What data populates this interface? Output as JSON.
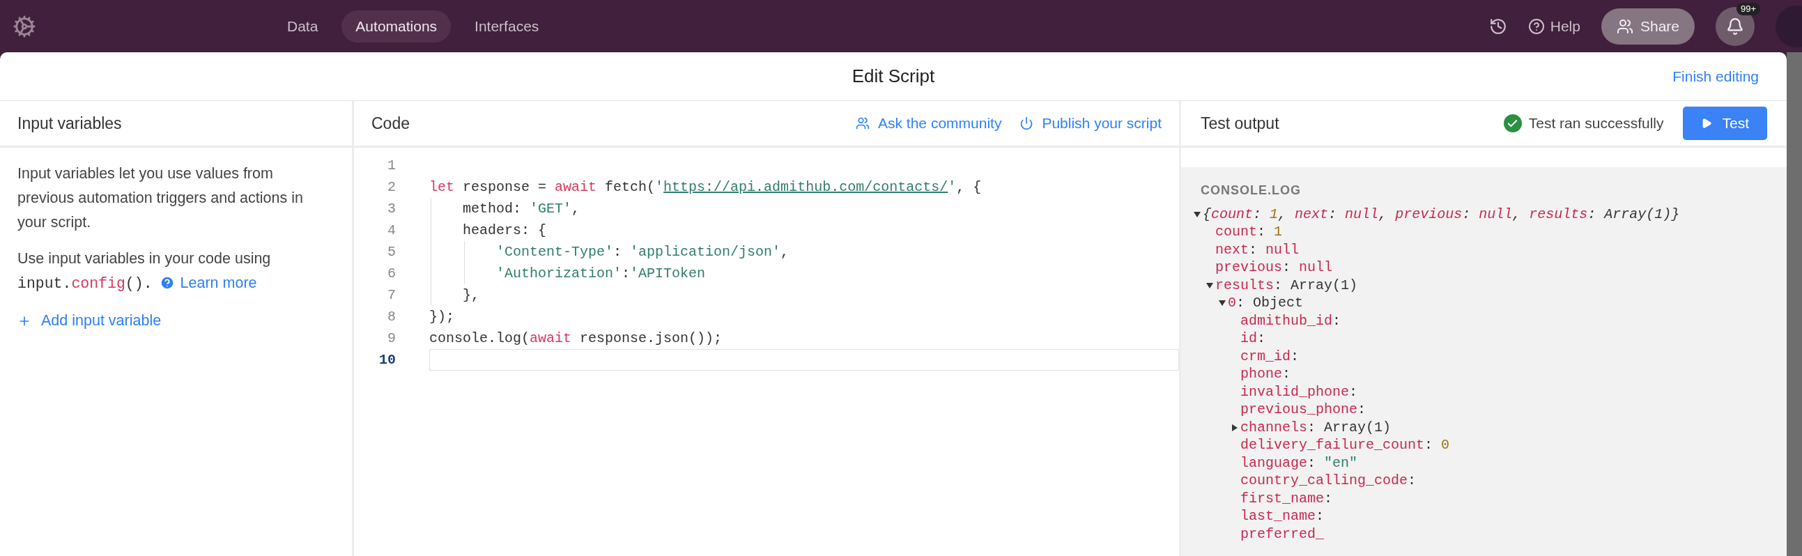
{
  "top_nav": {
    "tabs": [
      {
        "label": "Data",
        "selected": false
      },
      {
        "label": "Automations",
        "selected": true
      },
      {
        "label": "Interfaces",
        "selected": false
      }
    ],
    "help": "Help",
    "share": "Share",
    "notification_badge": "99+"
  },
  "dialog": {
    "title": "Edit Script",
    "finish": "Finish editing"
  },
  "input_panel": {
    "title": "Input variables",
    "description": "Input variables let you use values from previous automation triggers and actions in your script.",
    "usage": [
      {
        "kind": "text",
        "text": "Use input variables in your code using "
      },
      {
        "kind": "code",
        "text": "input."
      },
      {
        "kind": "code_red",
        "text": "config"
      },
      {
        "kind": "code",
        "text": "()."
      }
    ],
    "learn_more": "Learn more",
    "add": "Add input variable"
  },
  "code_panel": {
    "title": "Code",
    "ask": "Ask the community",
    "publish": "Publish your script",
    "lines": [
      {
        "number": "1",
        "current": false
      },
      {
        "number": "2",
        "current": false,
        "tokens": [
          {
            "kind": "keyword",
            "text": "let"
          },
          {
            "kind": "plain",
            "text": " response = "
          },
          {
            "kind": "keyword",
            "text": "await"
          },
          {
            "kind": "plain",
            "text": " fetch("
          },
          {
            "kind": "string",
            "text": "'"
          },
          {
            "kind": "link",
            "text": "https://api.admithub.com/contacts/"
          },
          {
            "kind": "string",
            "text": "'"
          },
          {
            "kind": "plain",
            "text": ", {"
          }
        ]
      },
      {
        "number": "3",
        "current": false,
        "tokens": [
          {
            "kind": "plain",
            "text": "    method: "
          },
          {
            "kind": "string",
            "text": "'GET'"
          },
          {
            "kind": "plain",
            "text": ","
          }
        ]
      },
      {
        "number": "4",
        "current": false,
        "tokens": [
          {
            "kind": "plain",
            "text": "    headers: {"
          }
        ]
      },
      {
        "number": "5",
        "current": false,
        "tokens": [
          {
            "kind": "string",
            "text": "        'Content-Type'"
          },
          {
            "kind": "plain",
            "text": ": "
          },
          {
            "kind": "string",
            "text": "'application/json'"
          },
          {
            "kind": "plain",
            "text": ","
          }
        ]
      },
      {
        "number": "6",
        "current": false,
        "tokens": [
          {
            "kind": "string",
            "text": "        'Authorization'"
          },
          {
            "kind": "plain",
            "text": ":"
          },
          {
            "kind": "string",
            "text": "'APIToken"
          }
        ]
      },
      {
        "number": "7",
        "current": false,
        "tokens": [
          {
            "kind": "plain",
            "text": "    },"
          }
        ]
      },
      {
        "number": "8",
        "current": false,
        "tokens": [
          {
            "kind": "plain",
            "text": "});"
          }
        ]
      },
      {
        "number": "9",
        "current": false,
        "tokens": [
          {
            "kind": "plain",
            "text": "console.log("
          },
          {
            "kind": "keyword",
            "text": "await"
          },
          {
            "kind": "plain",
            "text": " response.json());"
          }
        ]
      },
      {
        "number": "10",
        "current": true
      }
    ]
  },
  "output_panel": {
    "title": "Test output",
    "status": "Test ran successfully",
    "test_button": "Test",
    "console_label": "CONSOLE.LOG",
    "tree": [
      {
        "expanded": true,
        "tokens": [
          {
            "kind": "italic",
            "text": "{"
          },
          {
            "kind": "key_italic",
            "text": "count"
          },
          {
            "kind": "italic",
            "text": ": "
          },
          {
            "kind": "number_italic",
            "text": "1"
          },
          {
            "kind": "italic",
            "text": ", "
          },
          {
            "kind": "key_italic",
            "text": "next"
          },
          {
            "kind": "italic",
            "text": ": "
          },
          {
            "kind": "key_italic",
            "text": "null"
          },
          {
            "kind": "italic",
            "text": ", "
          },
          {
            "kind": "key_italic",
            "text": "previous"
          },
          {
            "kind": "italic",
            "text": ": "
          },
          {
            "kind": "key_italic",
            "text": "null"
          },
          {
            "kind": "italic",
            "text": ", "
          },
          {
            "kind": "key_italic",
            "text": "results"
          },
          {
            "kind": "italic",
            "text": ": Array(1)}"
          }
        ],
        "children": [
          {
            "tokens": [
              {
                "kind": "key",
                "text": "count"
              },
              {
                "kind": "plain",
                "text": ": "
              },
              {
                "kind": "number",
                "text": "1"
              }
            ]
          },
          {
            "tokens": [
              {
                "kind": "key",
                "text": "next"
              },
              {
                "kind": "plain",
                "text": ": "
              },
              {
                "kind": "key",
                "text": "null"
              }
            ]
          },
          {
            "tokens": [
              {
                "kind": "key",
                "text": "previous"
              },
              {
                "kind": "plain",
                "text": ": "
              },
              {
                "kind": "key",
                "text": "null"
              }
            ]
          },
          {
            "expanded": true,
            "tokens": [
              {
                "kind": "key",
                "text": "results"
              },
              {
                "kind": "plain",
                "text": ": Array(1)"
              }
            ],
            "children": [
              {
                "expanded": true,
                "tokens": [
                  {
                    "kind": "key",
                    "text": "0"
                  },
                  {
                    "kind": "plain",
                    "text": ": Object"
                  }
                ],
                "children": [
                  {
                    "tokens": [
                      {
                        "kind": "key",
                        "text": "admithub_id"
                      },
                      {
                        "kind": "plain",
                        "text": ":"
                      }
                    ]
                  },
                  {
                    "tokens": [
                      {
                        "kind": "key",
                        "text": "id"
                      },
                      {
                        "kind": "plain",
                        "text": ":"
                      }
                    ]
                  },
                  {
                    "tokens": [
                      {
                        "kind": "key",
                        "text": "crm_id"
                      },
                      {
                        "kind": "plain",
                        "text": ":"
                      }
                    ]
                  },
                  {
                    "tokens": [
                      {
                        "kind": "key",
                        "text": "phone"
                      },
                      {
                        "kind": "plain",
                        "text": ":"
                      }
                    ]
                  },
                  {
                    "tokens": [
                      {
                        "kind": "key",
                        "text": "invalid_phone"
                      },
                      {
                        "kind": "plain",
                        "text": ":"
                      }
                    ]
                  },
                  {
                    "tokens": [
                      {
                        "kind": "key",
                        "text": "previous_phone"
                      },
                      {
                        "kind": "plain",
                        "text": ":"
                      }
                    ]
                  },
                  {
                    "expanded": false,
                    "tokens": [
                      {
                        "kind": "key",
                        "text": "channels"
                      },
                      {
                        "kind": "plain",
                        "text": ": Array(1)"
                      }
                    ]
                  },
                  {
                    "tokens": [
                      {
                        "kind": "key",
                        "text": "delivery_failure_count"
                      },
                      {
                        "kind": "plain",
                        "text": ": "
                      },
                      {
                        "kind": "number",
                        "text": "0"
                      }
                    ]
                  },
                  {
                    "tokens": [
                      {
                        "kind": "key",
                        "text": "language"
                      },
                      {
                        "kind": "plain",
                        "text": ": "
                      },
                      {
                        "kind": "string",
                        "text": "\"en\""
                      }
                    ]
                  },
                  {
                    "tokens": [
                      {
                        "kind": "key",
                        "text": "country_calling_code"
                      },
                      {
                        "kind": "plain",
                        "text": ":"
                      }
                    ]
                  },
                  {
                    "tokens": [
                      {
                        "kind": "key",
                        "text": "first_name"
                      },
                      {
                        "kind": "plain",
                        "text": ":"
                      }
                    ]
                  },
                  {
                    "tokens": [
                      {
                        "kind": "key",
                        "text": "last_name"
                      },
                      {
                        "kind": "plain",
                        "text": ":"
                      }
                    ]
                  },
                  {
                    "tokens": [
                      {
                        "kind": "key",
                        "text": "preferred_"
                      }
                    ]
                  }
                ]
              }
            ]
          }
        ]
      }
    ]
  }
}
